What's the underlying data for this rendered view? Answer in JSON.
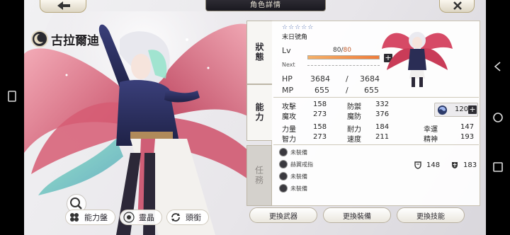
{
  "header": {
    "title": "角色詳情",
    "back_icon": "back-arrow-icon",
    "close_icon": "close-icon"
  },
  "character": {
    "name": "古拉爾迪",
    "rarity": "☆☆☆☆☆",
    "role": "末日號角"
  },
  "level": {
    "label": "Lv",
    "current": "80",
    "separator": "/",
    "max": "80",
    "next_label": "Next",
    "progress": 1.0
  },
  "vitals": {
    "hp_label": "HP",
    "hp_cur": "3684",
    "hp_sep": "/",
    "hp_max": "3684",
    "mp_label": "MP",
    "mp_cur": "655",
    "mp_sep": "/",
    "mp_max": "655"
  },
  "tabs": [
    {
      "label": "狀態",
      "state": "active"
    },
    {
      "label": "能力",
      "state": "active"
    },
    {
      "label": "任務",
      "state": "inactive"
    }
  ],
  "stats": {
    "atk_label": "攻擊",
    "atk": "158",
    "def_label": "防禦",
    "def": "332",
    "matk_label": "魔攻",
    "matk": "273",
    "mdef_label": "魔防",
    "mdef": "376",
    "str_label": "力量",
    "str": "158",
    "vit_label": "耐力",
    "vit": "184",
    "luck_label": "幸運",
    "luck": "147",
    "int_label": "智力",
    "int": "273",
    "spd_label": "速度",
    "spd": "211",
    "spi_label": "精神",
    "spi": "193",
    "power": "120"
  },
  "equipment": [
    {
      "label": "未裝備"
    },
    {
      "label": "赫翼戒指"
    },
    {
      "label": "未裝備"
    },
    {
      "label": "未裝備"
    }
  ],
  "defense": {
    "physical": "148",
    "magic": "183"
  },
  "bottom_buttons": {
    "ability_board": "能力盤",
    "spirit": "靈晶",
    "title": "頭銜"
  },
  "actions": {
    "change_weapon": "更換武器",
    "change_gear": "更換裝備",
    "change_skill": "更換技能"
  },
  "colors": {
    "accent": "#f07c3a",
    "dark": "#2c2b31",
    "wing": "#d9546b"
  }
}
